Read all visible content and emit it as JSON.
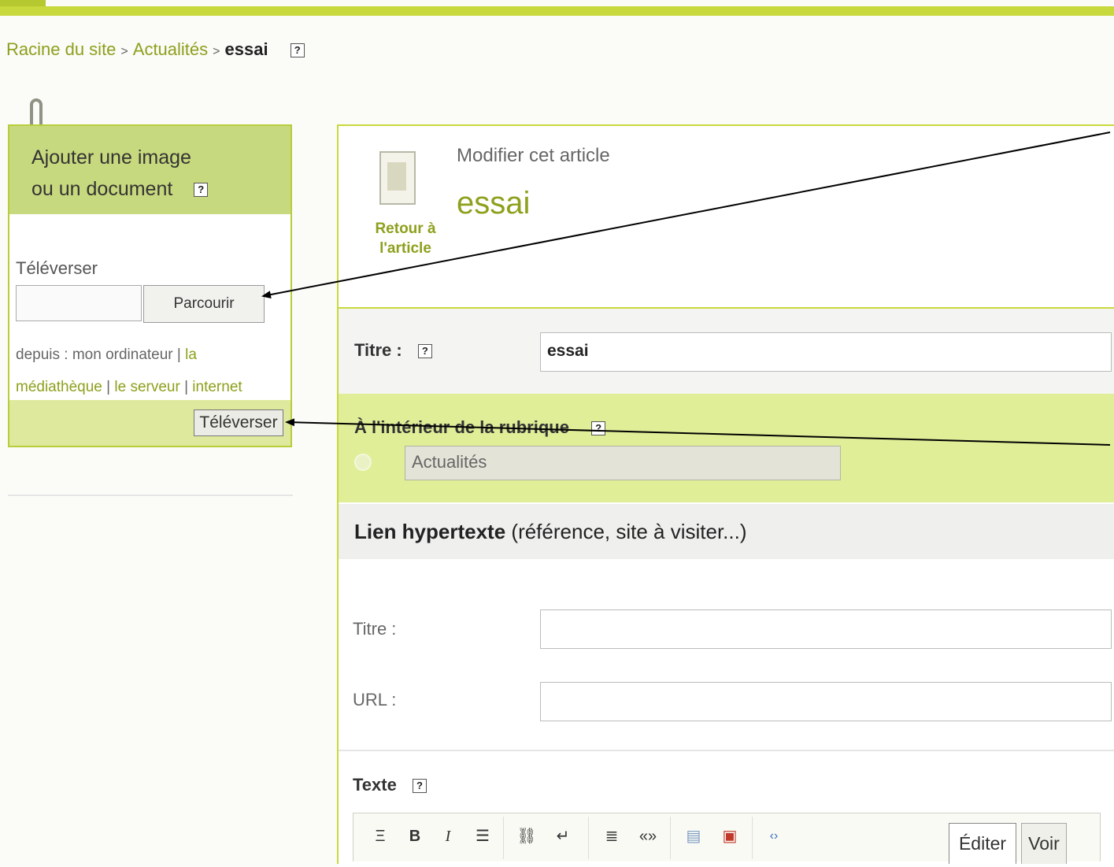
{
  "breadcrumb": {
    "root": "Racine du site",
    "section": "Actualités",
    "current": "essai",
    "separator": ">"
  },
  "help_icon_text": "?",
  "upload": {
    "title_line1": "Ajouter une image",
    "title_line2": "ou un document",
    "label": "Téléverser",
    "browse_button": "Parcourir",
    "sources_prefix": "depuis : ",
    "source_computer": "mon ordinateur",
    "source_media": "la médiathèque",
    "source_server": "le serveur",
    "source_internet": "internet",
    "pipe": "|",
    "submit_button": "Téléverser"
  },
  "article": {
    "back_link": "Retour à l'article",
    "modify_label": "Modifier cet article",
    "title": "essai"
  },
  "form": {
    "title_label": "Titre :",
    "title_value": "essai",
    "rubric_label": "À l'intérieur de la rubrique",
    "rubric_value": "Actualités",
    "link_heading_bold": "Lien hypertexte",
    "link_heading_rest": "(référence, site à visiter...)",
    "link_title_label": "Titre :",
    "link_title_value": "",
    "link_url_label": "URL :",
    "link_url_value": "",
    "text_label": "Texte"
  },
  "toolbar": {
    "buttons": [
      {
        "icon": "heading-icon",
        "glyph": "Ξ"
      },
      {
        "icon": "bold-icon",
        "glyph": "B"
      },
      {
        "icon": "italic-icon",
        "glyph": "I"
      },
      {
        "icon": "list-icon",
        "glyph": "☰"
      },
      {
        "icon": "link-icon",
        "glyph": "⛓"
      },
      {
        "icon": "footnote-icon",
        "glyph": "↵"
      },
      {
        "icon": "align-icon",
        "glyph": "≣"
      },
      {
        "icon": "quote-icon",
        "glyph": "«»"
      },
      {
        "icon": "media-icon",
        "glyph": "▤"
      },
      {
        "icon": "document-icon",
        "glyph": "▣"
      },
      {
        "icon": "code-icon",
        "glyph": "‹›"
      }
    ],
    "tab_edit": "Éditer",
    "tab_view": "Voir"
  },
  "colors": {
    "accent": "#c7d93c",
    "link": "#8ea01c",
    "header_green": "#c7d97e"
  }
}
